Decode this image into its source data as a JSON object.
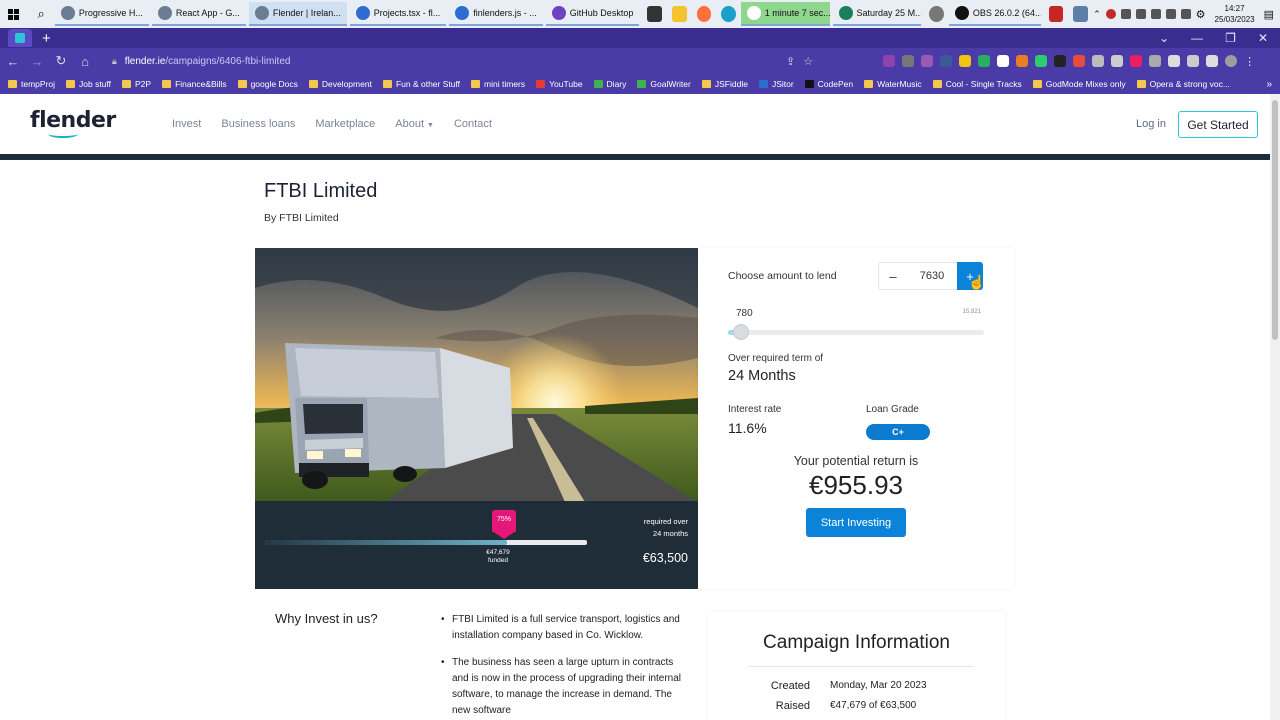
{
  "taskbar": {
    "tasks": [
      {
        "label": "Progressive H...",
        "color": "#6b7c93",
        "state": "normal"
      },
      {
        "label": "React App - G...",
        "color": "#6b7c93",
        "state": "normal"
      },
      {
        "label": "Flender | Irelan...",
        "color": "#6b7c93",
        "state": "active"
      },
      {
        "label": "Projects.tsx - fl...",
        "color": "#2f6cd1",
        "state": "normal"
      },
      {
        "label": "finlenders.js - ...",
        "color": "#2f6cd1",
        "state": "normal"
      },
      {
        "label": "GitHub Desktop",
        "color": "#6f42c1",
        "state": "normal"
      }
    ],
    "timer_task": {
      "label": "1 minute 7 sec...",
      "color": "#ffffff"
    },
    "date_task": {
      "label": "Saturday 25 M...",
      "color": "#1a7f5a"
    },
    "obs_task": {
      "label": "OBS 26.0.2 (64...",
      "color": "#111111"
    },
    "clock_time": "14:27",
    "clock_date": "25/03/2023"
  },
  "browser": {
    "window_controls": [
      "⌄",
      "—",
      "❐",
      "✕"
    ],
    "new_tab": "+",
    "url_host": "flender.ie",
    "url_path": "/campaigns/6406-ftbi-limited",
    "bookmarks": [
      {
        "label": "tempProj",
        "icon": "folder"
      },
      {
        "label": "Job stuff",
        "icon": "folder"
      },
      {
        "label": "P2P",
        "icon": "folder"
      },
      {
        "label": "Finance&Bills",
        "icon": "folder"
      },
      {
        "label": "google Docs",
        "icon": "folder"
      },
      {
        "label": "Development",
        "icon": "folder"
      },
      {
        "label": "Fun & other Stuff",
        "icon": "folder"
      },
      {
        "label": "mini timers",
        "icon": "folder"
      },
      {
        "label": "YouTube",
        "icon": "yt"
      },
      {
        "label": "Diary",
        "icon": "green"
      },
      {
        "label": "GoalWriter",
        "icon": "green"
      },
      {
        "label": "JSFiddle",
        "icon": "folder"
      },
      {
        "label": "JSitor",
        "icon": "blue"
      },
      {
        "label": "CodePen",
        "icon": "dark"
      },
      {
        "label": "WaterMusic",
        "icon": "folder"
      },
      {
        "label": "Cool - Single Tracks",
        "icon": "folder"
      },
      {
        "label": "GodMode Mixes only",
        "icon": "folder"
      },
      {
        "label": "Opera & strong voc...",
        "icon": "folder"
      }
    ],
    "bookmarks_more": "»"
  },
  "site": {
    "logo": "flender",
    "nav": {
      "invest": "Invest",
      "business_loans": "Business loans",
      "marketplace": "Marketplace",
      "about": "About",
      "contact": "Contact"
    },
    "login": "Log in",
    "get_started": "Get Started"
  },
  "campaign": {
    "title": "FTBI Limited",
    "byline": "By FTBI Limited",
    "funded_percent_label": "75%",
    "funded_fraction": 0.75,
    "funded_amount": "€47,679",
    "funded_label": "funded",
    "required_line1": "required over",
    "required_line2": "24 months",
    "target_amount": "€63,500"
  },
  "invest": {
    "choose_label": "Choose amount to lend",
    "minus": "–",
    "plus": "+",
    "amount": "7630",
    "slider_value": "780",
    "slider_max": "15,821",
    "slider_fraction": 0.05,
    "term_label": "Over required term of",
    "term_value": "24 Months",
    "rate_label": "Interest rate",
    "rate_value": "11.6%",
    "grade_label": "Loan Grade",
    "grade_value": "C+",
    "return_label": "Your potential return is",
    "return_value": "€955.93",
    "start_button": "Start Investing"
  },
  "why": {
    "title": "Why Invest in us?",
    "bullets": [
      "FTBI Limited is a full service transport, logistics and installation company based in Co. Wicklow.",
      "The business has seen a large upturn in contracts and is now in the process of upgrading their internal software, to manage the increase in demand. The new software"
    ]
  },
  "campaign_info": {
    "title": "Campaign Information",
    "created_label": "Created",
    "created_value": "Monday, Mar 20 2023",
    "raised_label": "Raised",
    "raised_value": "€47,679 of €63,500"
  },
  "colors": {
    "brand_blue": "#0b83d9",
    "accent_teal": "#2ec4d8",
    "dark_panel": "#1f2d38",
    "badge_pink": "#e6177a",
    "browser_purple": "#4a3ba6"
  }
}
